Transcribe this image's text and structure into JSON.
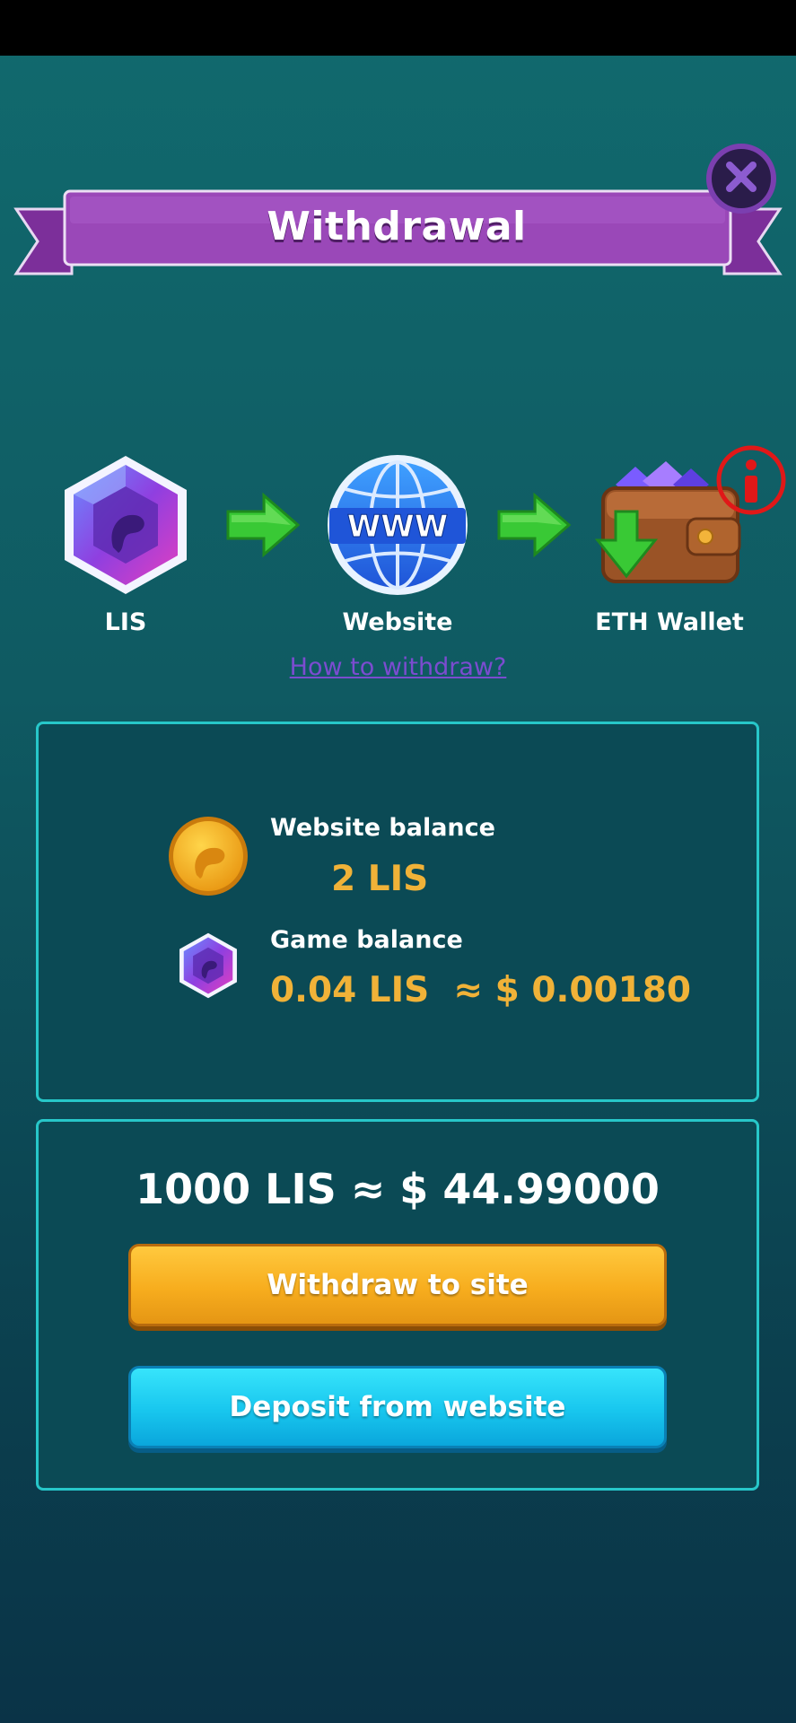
{
  "title": "Withdrawal",
  "close_icon": "close-icon",
  "flow": {
    "steps": [
      {
        "label": "LIS",
        "icon": "lis-gem-icon"
      },
      {
        "label": "Website",
        "icon": "globe-www-icon"
      },
      {
        "label": "ETH Wallet",
        "icon": "wallet-icon"
      }
    ],
    "globe_text": "WWW",
    "info_icon": "info-icon"
  },
  "how_to_link": "How to withdraw?",
  "balances": {
    "website_label": "Website balance",
    "website_value": "2 LIS",
    "game_label": "Game balance",
    "game_value": "0.04 LIS  ≈ $ 0.00180"
  },
  "exchange": {
    "rate": "1000 LIS ≈ $ 44.99000",
    "withdraw_button": "Withdraw to site",
    "deposit_button": "Deposit from website"
  },
  "colors": {
    "accent_gold": "#f0b238",
    "panel_border": "#27c7c9",
    "ribbon_purple": "#9a48b8",
    "link_purple": "#7b4cd0"
  }
}
